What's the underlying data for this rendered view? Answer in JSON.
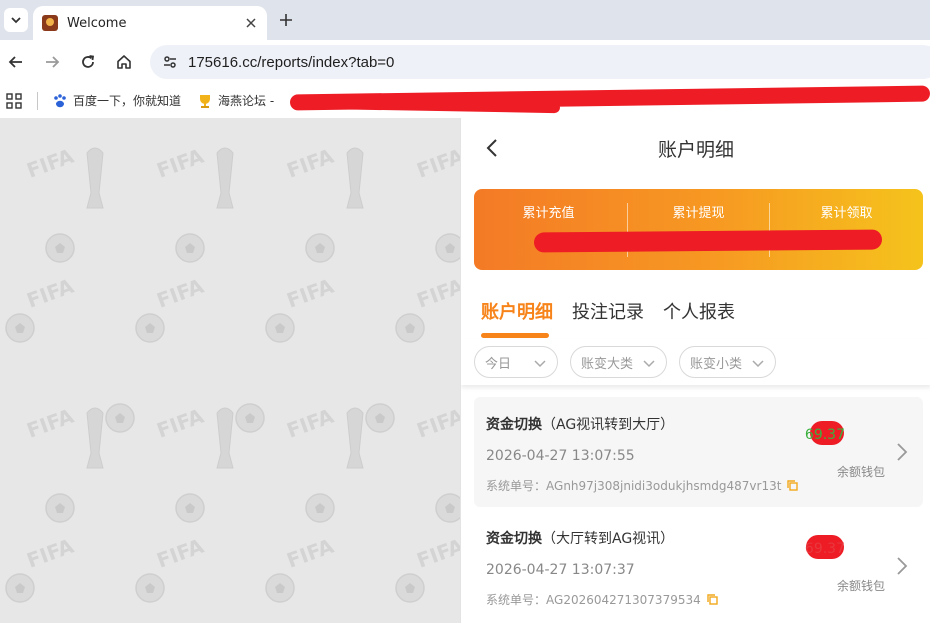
{
  "browser": {
    "tab_title": "Welcome",
    "url": "175616.cc/reports/index?tab=0",
    "bookmarks": [
      {
        "label": "百度一下，你就知道",
        "icon": "baidu-paw-icon"
      },
      {
        "label": "海燕论坛 -",
        "icon": "trophy-icon"
      }
    ]
  },
  "panel": {
    "title": "账户明细",
    "summary": {
      "labels": [
        "累计充值",
        "累计提现",
        "累计领取"
      ]
    },
    "tabs": [
      "账户明细",
      "投注记录",
      "个人报表"
    ],
    "filters": [
      "今日",
      "账变大类",
      "账变小类"
    ],
    "records": [
      {
        "title": "资金切换",
        "detail": "（AG视讯转到大厅）",
        "time": "2026-04-27 13:07:55",
        "order_label": "系统单号：",
        "order_no": "AGnh97j308jnidi3odukjhsmdg487vr13t",
        "amount": "69.37",
        "amount_color": "#3ab03e",
        "wallet": "余额钱包"
      },
      {
        "title": "资金切换",
        "detail": "（大厅转到AG视讯）",
        "time": "2026-04-27 13:07:37",
        "order_label": "系统单号：",
        "order_no": "AG202604271307379534",
        "amount": "69.37",
        "amount_color": "#e8383d",
        "wallet": "余额钱包"
      }
    ]
  },
  "colors": {
    "accent": "#f7841b",
    "redaction": "#ee1c25"
  }
}
